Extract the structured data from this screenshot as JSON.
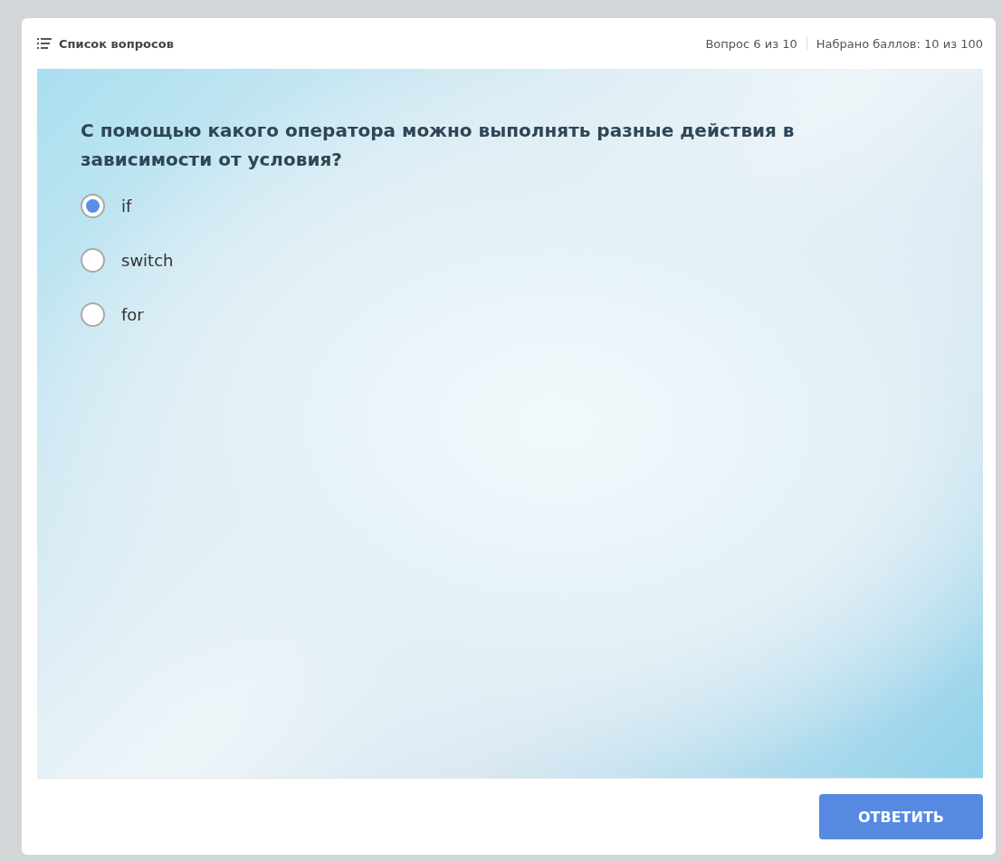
{
  "header": {
    "list_label": "Список вопросов",
    "progress": "Вопрос 6 из 10",
    "score": "Набрано баллов: 10 из 100"
  },
  "question": {
    "text": "С помощью какого оператора можно выполнять разные действия в зависимости от условия?",
    "options": [
      {
        "label": "if",
        "selected": true
      },
      {
        "label": "switch",
        "selected": false
      },
      {
        "label": "for",
        "selected": false
      }
    ]
  },
  "submit_button": "ОТВЕТИТЬ"
}
